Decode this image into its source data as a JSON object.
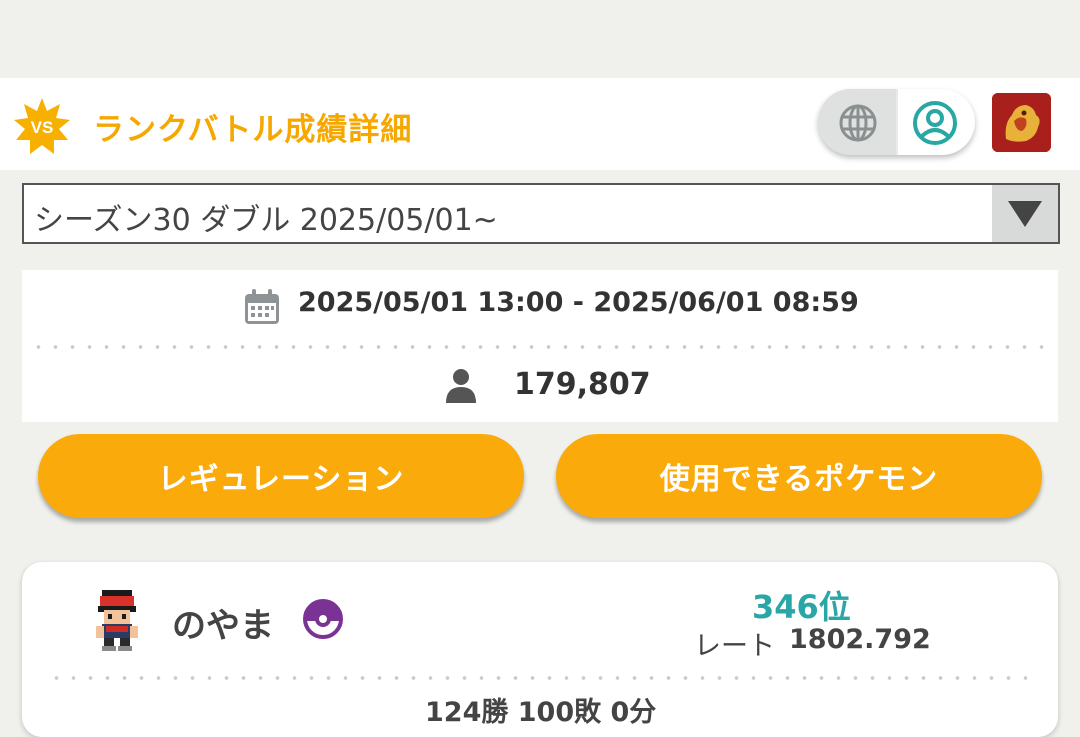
{
  "header": {
    "title": "ランクバトル成績詳細",
    "badge_label": "VS",
    "accent_color": "#f6a800"
  },
  "season_select": {
    "selected": "シーズン30 ダブル 2025/05/01~"
  },
  "season_info": {
    "period": "2025/05/01 13:00 - 2025/06/01 08:59",
    "players": "179,807"
  },
  "buttons": {
    "regulation": "レギュレーション",
    "usable_pokemon": "使用できるポケモン"
  },
  "player": {
    "name": "のやま",
    "rank": "346位",
    "rate_label": "レート",
    "rate_value": "1802.792",
    "record": "124勝 100敗 0分"
  },
  "icons": {
    "badge": "vs-badge-icon",
    "globe": "globe-icon",
    "user": "user-circle-icon",
    "game": "game-logo-icon",
    "calendar": "calendar-icon",
    "person": "person-icon",
    "ball": "monster-ball-icon",
    "dropdown": "dropdown-arrow-icon"
  }
}
